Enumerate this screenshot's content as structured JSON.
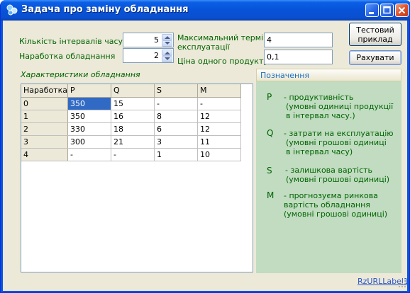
{
  "window": {
    "title": "Задача про заміну обладнання"
  },
  "fields": {
    "intervals": {
      "label": "Кількість інтервалів часу",
      "value": "5"
    },
    "equipment_age": {
      "label": "Наработка обладнання",
      "value": "2"
    },
    "max_term": {
      "label_line1": "Максимальний термін",
      "label_line2": "експлуатації",
      "value": "4"
    },
    "unit_price": {
      "label": "Ціна одного продукту",
      "value": "0,1"
    }
  },
  "buttons": {
    "test_example_line1": "Тестовий",
    "test_example_line2": "приклад",
    "calculate": "Рахувати"
  },
  "table": {
    "caption": "Характеристики обладнання",
    "columns": [
      "Наработка",
      "P",
      "Q",
      "S",
      "M"
    ],
    "rows": [
      [
        "0",
        "350",
        "15",
        "-",
        "-"
      ],
      [
        "1",
        "350",
        "16",
        "8",
        "12"
      ],
      [
        "2",
        "330",
        "18",
        "6",
        "12"
      ],
      [
        "3",
        "300",
        "21",
        "3",
        "11"
      ],
      [
        "4",
        "-",
        "-",
        "1",
        "10"
      ]
    ]
  },
  "legend": {
    "title": "Позначення",
    "items": [
      {
        "symbol": "P",
        "lines": [
          "- продуктивність",
          "(умовні одиниці продукції",
          "в інтервал часу.)"
        ]
      },
      {
        "symbol": "Q",
        "lines": [
          "- затрати на експлуатацію",
          "(умовні грошові одиниці",
          "в інтервал часу)"
        ]
      },
      {
        "symbol": "S",
        "lines": [
          "- залишкова вартість",
          "(умовні грошові одиниці)"
        ]
      },
      {
        "symbol": "M",
        "lines": [
          "- прогнозуєма ринкова",
          "вартість обладнання",
          "(умовні грошові одиниці)"
        ]
      }
    ]
  },
  "footer": {
    "link": "RzURLLabel1"
  }
}
